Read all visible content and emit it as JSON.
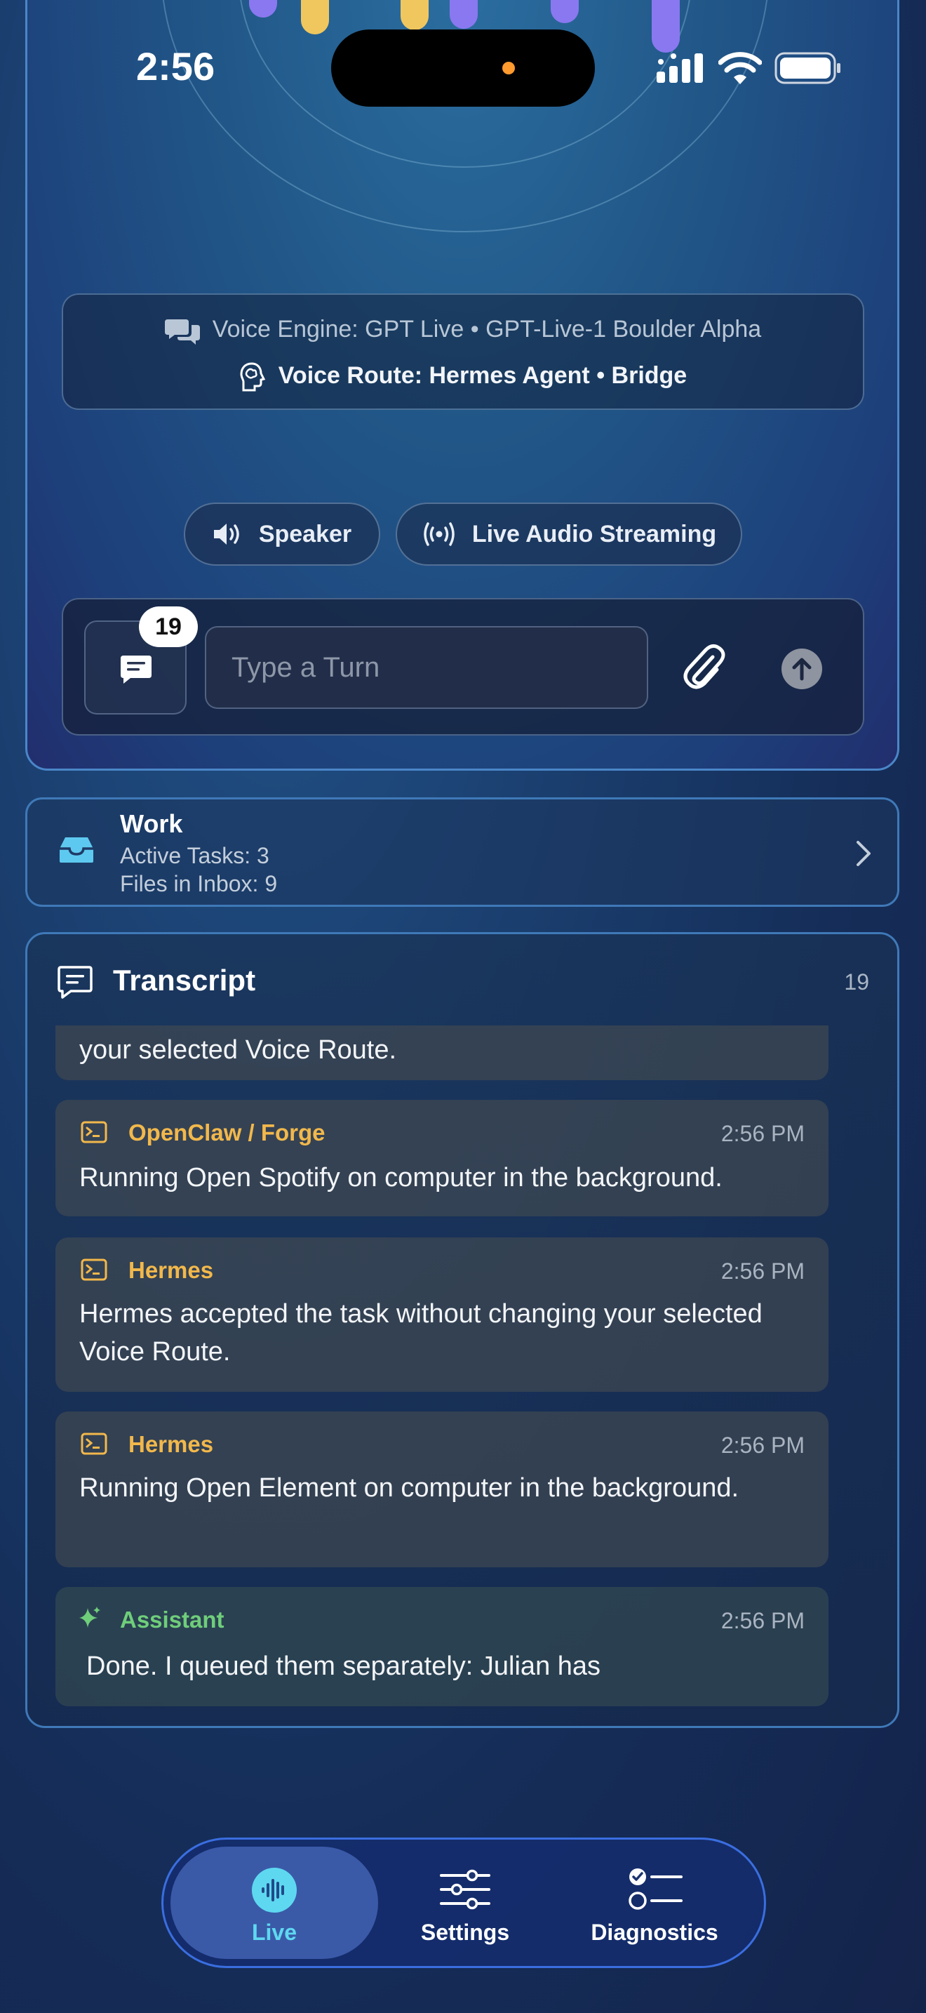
{
  "status_bar": {
    "time": "2:56"
  },
  "voice_info": {
    "engine": "Voice Engine: GPT Live • GPT-Live-1 Boulder Alpha",
    "route": "Voice Route: Hermes Agent • Bridge"
  },
  "audio_controls": {
    "speaker_label": "Speaker",
    "streaming_label": "Live Audio Streaming"
  },
  "composer": {
    "message_count": "19",
    "placeholder": "Type a Turn"
  },
  "work": {
    "title": "Work",
    "active_tasks": "Active Tasks: 3",
    "files_in_inbox": "Files in Inbox: 9"
  },
  "transcript": {
    "title": "Transcript",
    "count": "19",
    "entries": [
      {
        "sender": "",
        "time": "",
        "text": "your selected Voice Route."
      },
      {
        "sender": "OpenClaw / Forge",
        "time": "2:56 PM",
        "text": "Running Open Spotify on computer in the background."
      },
      {
        "sender": "Hermes",
        "time": "2:56 PM",
        "text": "Hermes accepted the task without changing your selected Voice Route."
      },
      {
        "sender": "Hermes",
        "time": "2:56 PM",
        "text": "Running Open Element on computer in the background."
      },
      {
        "sender": "Assistant",
        "time": "2:56 PM",
        "text": "Done. I queued them separately: Julian has"
      }
    ]
  },
  "tabs": [
    {
      "label": "Live",
      "active": true
    },
    {
      "label": "Settings",
      "active": false
    },
    {
      "label": "Diagnostics",
      "active": false
    }
  ],
  "colors": {
    "accent": "#5ed8f0",
    "agent_label": "#f2b84b",
    "assistant_label": "#6fce7a",
    "wave_yellow": "#f0c75e",
    "wave_purple": "#8a78f0"
  }
}
